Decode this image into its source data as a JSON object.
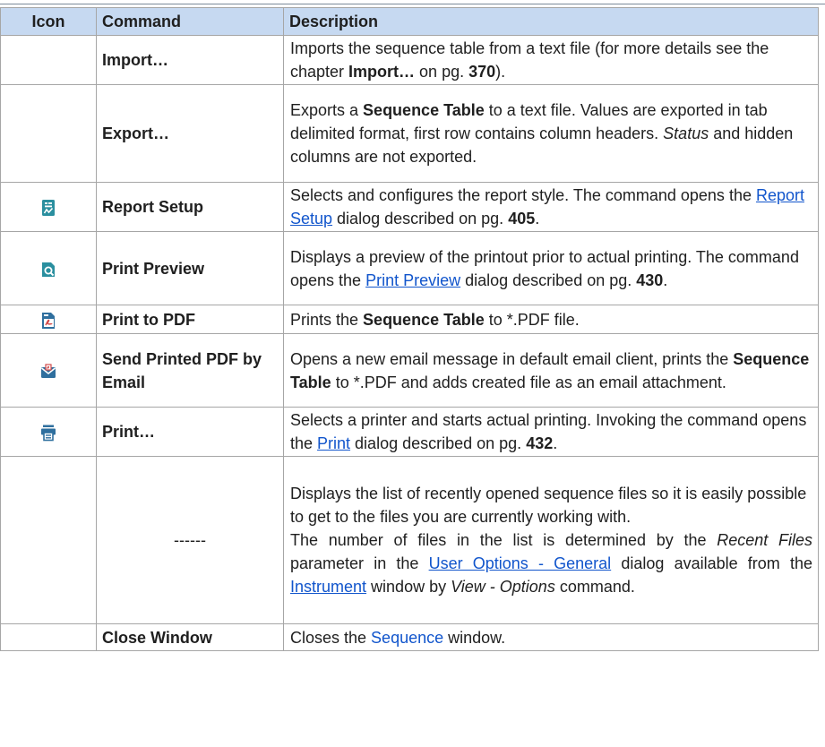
{
  "headers": {
    "icon": "Icon",
    "command": "Command",
    "description": "Description"
  },
  "rows": {
    "import": {
      "command": "Import…",
      "desc": {
        "t1": "Imports the sequence table from a text file (for more details see the chapter ",
        "b1": "Import…",
        "t2": " on pg. ",
        "b2": "370",
        "t3": ")."
      }
    },
    "export": {
      "command": "Export…",
      "desc": {
        "t1": "Exports a ",
        "b1": "Sequence Table",
        "t2": " to a text file. Values are exported in tab delimited format, first row contains column headers. ",
        "i1": "Status",
        "t3": " and hidden columns are not exported."
      }
    },
    "report_setup": {
      "icon": "report-setup-icon",
      "command": "Report Setup",
      "desc": {
        "t1": "Selects and configures the report style. The command opens the ",
        "l1": "Report Setup",
        "t2": " dialog described on pg. ",
        "b1": "405",
        "t3": "."
      }
    },
    "print_preview": {
      "icon": "print-preview-icon",
      "command": "Print Preview",
      "desc": {
        "t1": "Displays a preview of the printout prior to actual printing. The command opens the ",
        "l1": "Print Preview",
        "t2": " dialog described on pg. ",
        "b1": "430",
        "t3": "."
      }
    },
    "print_pdf": {
      "icon": "pdf-icon",
      "command": "Print to PDF",
      "desc": {
        "t1": "Prints the ",
        "b1": "Sequence Table",
        "t2": " to *.PDF file."
      }
    },
    "send_pdf": {
      "icon": "email-pdf-icon",
      "command": "Send Printed PDF by Email",
      "desc": {
        "t1": "Opens a new email message in default email client, prints the ",
        "b1": "Sequence Table",
        "t2": " to *.PDF and adds created file as an email attachment."
      }
    },
    "print": {
      "icon": "printer-icon",
      "command": "Print…",
      "desc": {
        "t1": "Selects a printer and starts actual printing. Invoking the command opens the ",
        "l1": "Print",
        "t2": " dialog described on pg. ",
        "b1": "432",
        "t3": "."
      }
    },
    "recent": {
      "command": "------",
      "desc": {
        "p1": "Displays the list of recently opened sequence files so it is easily possible to get to the files you are currently working with.",
        "t1": "The number of files in the list is determined by the ",
        "i1": "Recent Files",
        "t2": " parameter in the ",
        "l1": "User Options - General",
        "t3": " dialog available from the ",
        "l2": "Instrument",
        "t4": " window by ",
        "i2": "View - Options",
        "t5": " command."
      }
    },
    "close": {
      "command": "Close Window",
      "desc": {
        "t1": "Closes the ",
        "l1": "Sequence",
        "t2": " window."
      }
    }
  },
  "colors": {
    "header_bg": "#c6d9f1",
    "border": "#a6a6a6",
    "link": "#1155cc",
    "icon_teal": "#2a8f9f",
    "icon_blue": "#2f6f9e",
    "icon_red": "#d24b4b"
  }
}
